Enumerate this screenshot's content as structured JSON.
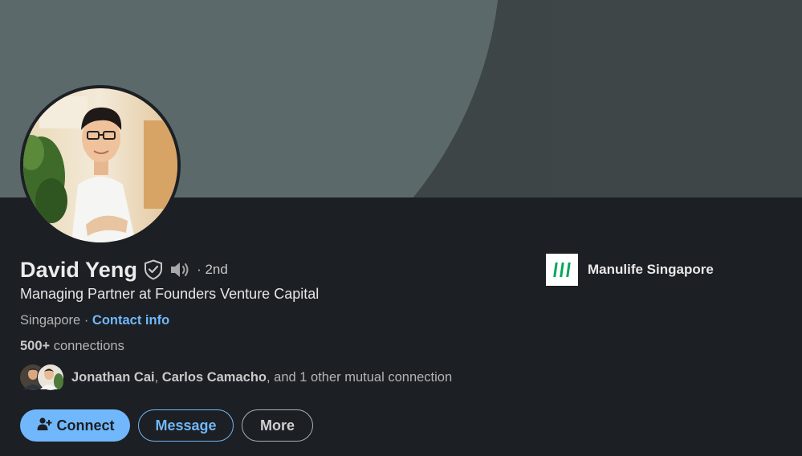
{
  "profile": {
    "name": "David Yeng",
    "degree": "· 2nd",
    "headline": "Managing Partner at Founders Venture Capital",
    "location": "Singapore",
    "location_separator": " · ",
    "contact_info": "Contact info",
    "connections_count": "500+",
    "connections_label": " connections",
    "mutual": {
      "name1": "Jonathan Cai",
      "separator": ", ",
      "name2": "Carlos Camacho",
      "rest": ", and 1 other mutual connection"
    }
  },
  "company": {
    "name": "Manulife Singapore"
  },
  "actions": {
    "connect_label": "Connect",
    "message_label": "Message",
    "more_label": "More"
  },
  "icons": {
    "verified": "shield-check-icon",
    "pronunciation": "speaker-icon",
    "connect": "add-person-icon",
    "company_logo": "manulife-logo"
  },
  "colors": {
    "background": "#1c1f23",
    "accent": "#71b7fb",
    "banner": "#5b696a",
    "brand_green": "#00a758"
  }
}
